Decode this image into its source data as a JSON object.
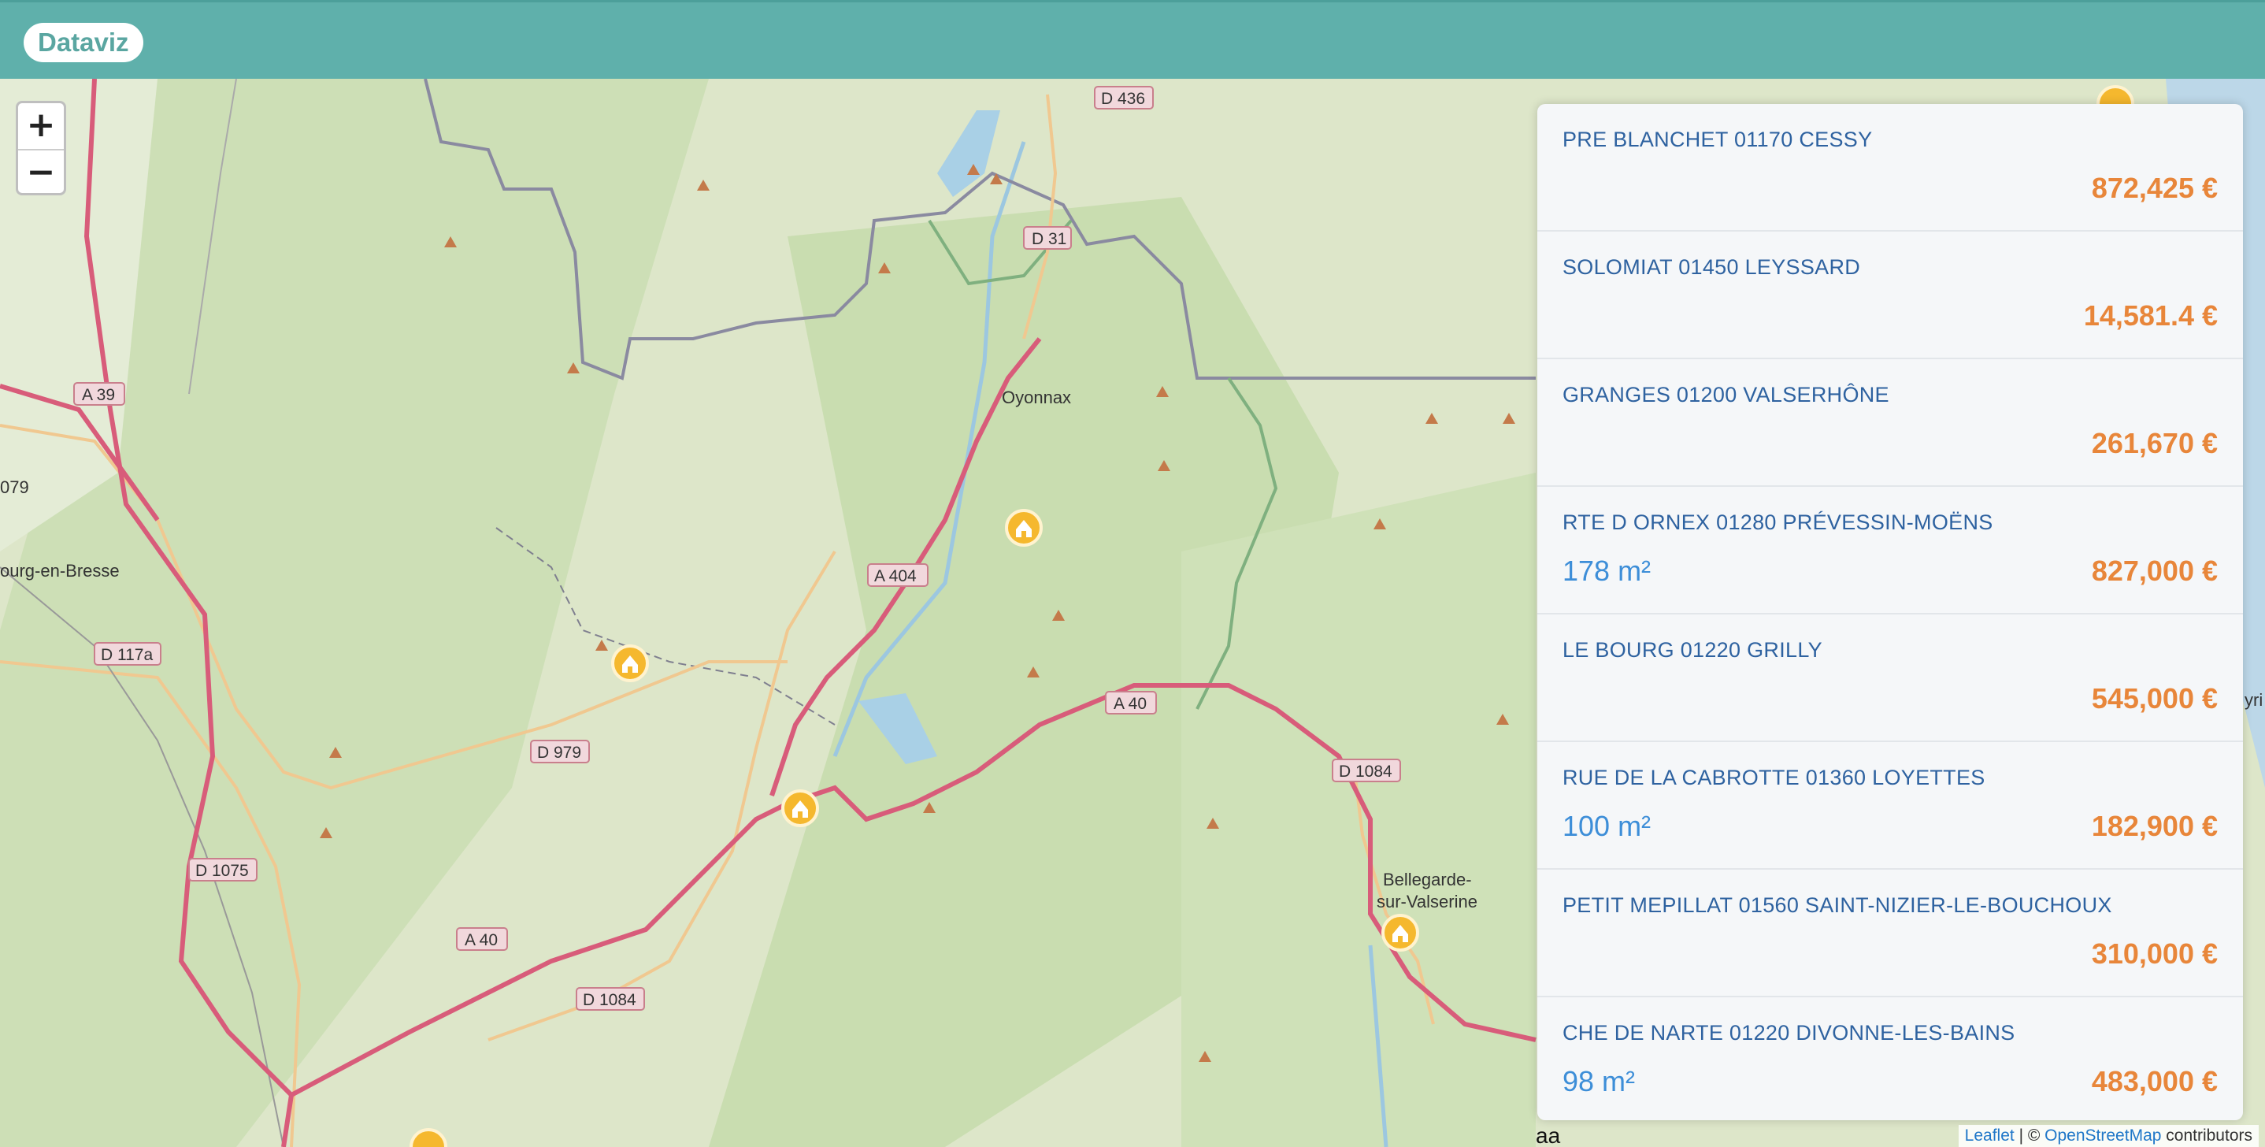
{
  "app": {
    "brand": "Dataviz"
  },
  "map": {
    "zoom_in": "+",
    "zoom_out": "−",
    "place_labels": [
      "Oyonnax",
      "ourg-en-Bresse",
      "Bellegarde-",
      "sur-Valserine",
      "yri",
      "079"
    ],
    "road_shields": [
      "D 436",
      "D 31",
      "A 39",
      "A 404",
      "D 117a",
      "A 40",
      "D 979",
      "D 1075",
      "A 40",
      "D 1084",
      "D 1084"
    ],
    "attribution": {
      "leaflet": "Leaflet",
      "separator": " | © ",
      "osm": "OpenStreetMap",
      "suffix": " contributors"
    },
    "stray_text": "aa"
  },
  "listings": [
    {
      "address": "PRE BLANCHET 01170 CESSY",
      "area": "",
      "price": "872,425 €"
    },
    {
      "address": "SOLOMIAT 01450 LEYSSARD",
      "area": "",
      "price": "14,581.4 €"
    },
    {
      "address": "GRANGES 01200 VALSERHÔNE",
      "area": "",
      "price": "261,670 €"
    },
    {
      "address": "RTE D ORNEX 01280 PRÉVESSIN-MOËNS",
      "area": "178 m²",
      "price": "827,000 €"
    },
    {
      "address": "LE BOURG 01220 GRILLY",
      "area": "",
      "price": "545,000 €"
    },
    {
      "address": "RUE DE LA CABROTTE 01360 LOYETTES",
      "area": "100 m²",
      "price": "182,900 €"
    },
    {
      "address": "PETIT MEPILLAT 01560 SAINT-NIZIER-LE-BOUCHOUX",
      "area": "",
      "price": "310,000 €"
    },
    {
      "address": "CHE DE NARTE 01220 DIVONNE-LES-BAINS",
      "area": "98 m²",
      "price": "483,000 €"
    }
  ],
  "colors": {
    "navbar": "#5fb0ab",
    "price": "#e8863a",
    "address": "#2e62a0",
    "area": "#3d8ed8",
    "marker": "#f5b82e"
  }
}
